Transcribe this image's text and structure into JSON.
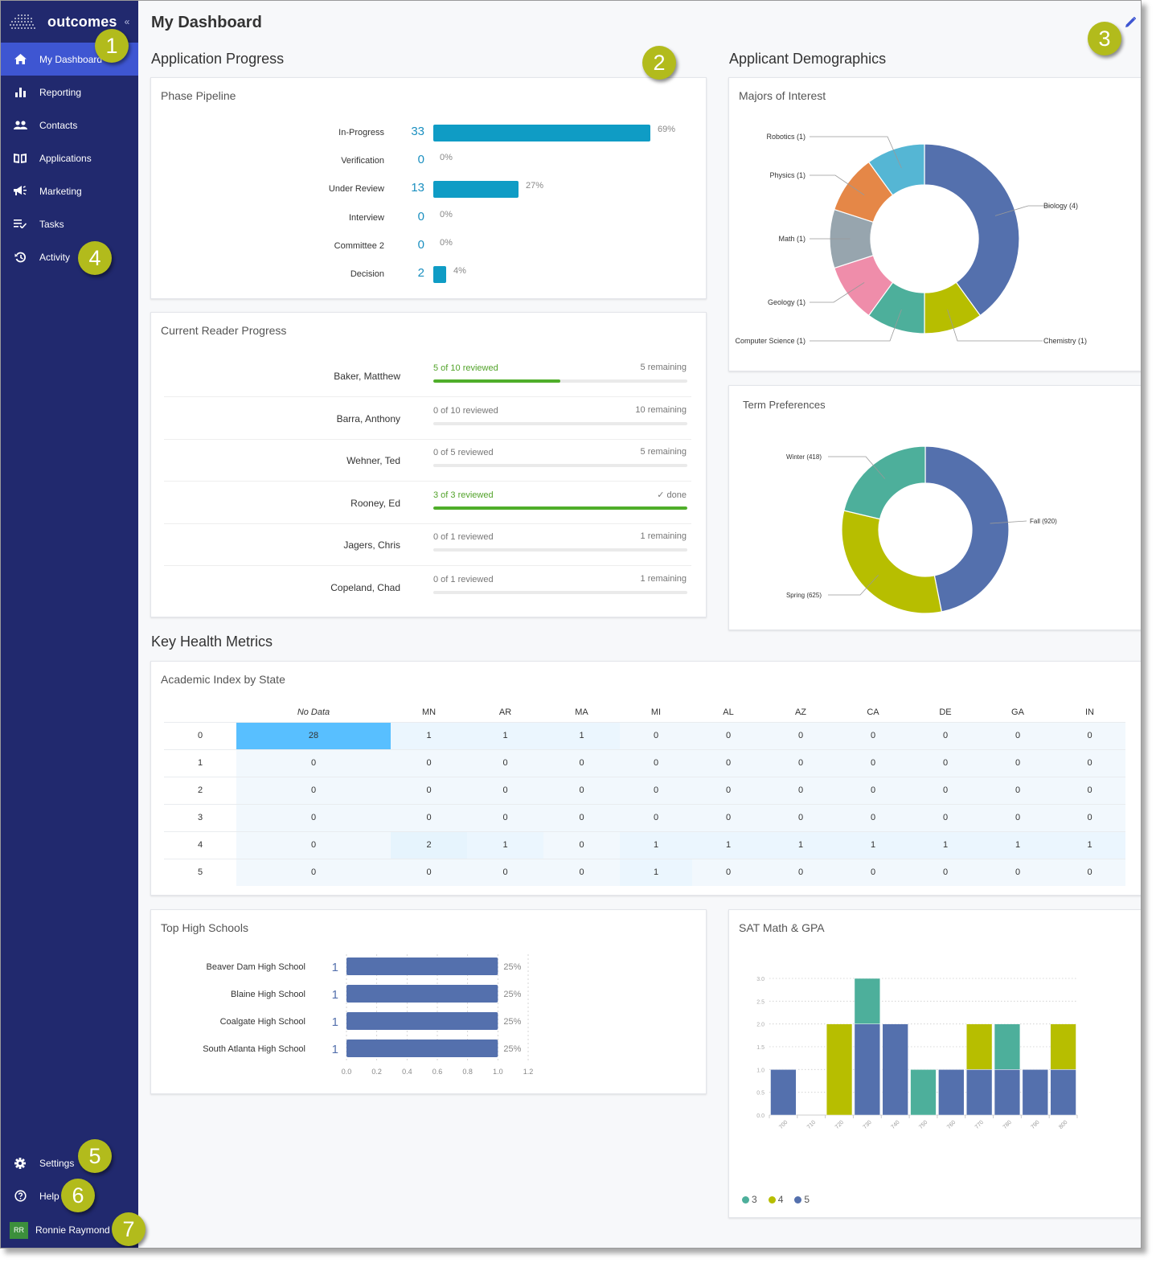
{
  "app": {
    "brand": "outcomes",
    "collapse_glyph": "«"
  },
  "sidebar": {
    "items": [
      {
        "label": "My Dashboard",
        "icon": "home-icon",
        "active": true
      },
      {
        "label": "Reporting",
        "icon": "bar-chart-icon",
        "active": false
      },
      {
        "label": "Contacts",
        "icon": "people-icon",
        "active": false
      },
      {
        "label": "Applications",
        "icon": "book-icon",
        "active": false
      },
      {
        "label": "Marketing",
        "icon": "megaphone-icon",
        "active": false
      },
      {
        "label": "Tasks",
        "icon": "tasks-icon",
        "active": false
      },
      {
        "label": "Activity",
        "icon": "history-icon",
        "active": false
      }
    ],
    "bottom": [
      {
        "label": "Settings",
        "icon": "gear-icon"
      },
      {
        "label": "Help",
        "icon": "help-icon"
      }
    ],
    "user": {
      "initials": "RR",
      "name": "Ronnie Raymond",
      "avatar_color": "#3c8f3c"
    }
  },
  "header": {
    "title": "My Dashboard",
    "edit_icon": "pencil-icon"
  },
  "sections": {
    "application_progress": "Application Progress",
    "applicant_demographics": "Applicant Demographics",
    "key_health_metrics": "Key Health Metrics"
  },
  "phase_pipeline": {
    "title": "Phase Pipeline",
    "bar_color": "#0f9cc5",
    "rows": [
      {
        "label": "In-Progress",
        "count": "33",
        "percent": "69%",
        "fraction": 0.69
      },
      {
        "label": "Verification",
        "count": "0",
        "percent": "0%",
        "fraction": 0
      },
      {
        "label": "Under Review",
        "count": "13",
        "percent": "27%",
        "fraction": 0.27
      },
      {
        "label": "Interview",
        "count": "0",
        "percent": "0%",
        "fraction": 0
      },
      {
        "label": "Committee 2",
        "count": "0",
        "percent": "0%",
        "fraction": 0
      },
      {
        "label": "Decision",
        "count": "2",
        "percent": "4%",
        "fraction": 0.04
      }
    ]
  },
  "reader_progress": {
    "title": "Current Reader Progress",
    "rows": [
      {
        "name": "Baker, Matthew",
        "status": "5 of 10 reviewed",
        "remaining": "5 remaining",
        "progress": 0.5,
        "highlight": true
      },
      {
        "name": "Barra, Anthony",
        "status": "0 of 10 reviewed",
        "remaining": "10 remaining",
        "progress": 0,
        "highlight": false
      },
      {
        "name": "Wehner, Ted",
        "status": "0 of 5 reviewed",
        "remaining": "5 remaining",
        "progress": 0,
        "highlight": false
      },
      {
        "name": "Rooney, Ed",
        "status": "3 of 3 reviewed",
        "remaining": "✓ done",
        "progress": 1,
        "highlight": true
      },
      {
        "name": "Jagers, Chris",
        "status": "0 of 1 reviewed",
        "remaining": "1 remaining",
        "progress": 0,
        "highlight": false
      },
      {
        "name": "Copeland, Chad",
        "status": "0 of 1 reviewed",
        "remaining": "1 remaining",
        "progress": 0,
        "highlight": false
      }
    ]
  },
  "majors": {
    "title": "Majors of Interest",
    "slices": [
      {
        "label": "Biology (4)",
        "value": 4,
        "color": "#5470ad"
      },
      {
        "label": "Chemistry (1)",
        "value": 1,
        "color": "#b7be00"
      },
      {
        "label": "Computer Science (1)",
        "value": 1,
        "color": "#4daf9b"
      },
      {
        "label": "Geology (1)",
        "value": 1,
        "color": "#ef8daa"
      },
      {
        "label": "Math (1)",
        "value": 1,
        "color": "#97a5ae"
      },
      {
        "label": "Physics (1)",
        "value": 1,
        "color": "#e58747"
      },
      {
        "label": "Robotics (1)",
        "value": 1,
        "color": "#55b6d4"
      }
    ]
  },
  "terms": {
    "title": "Term Preferences",
    "slices": [
      {
        "label": "Fall (920)",
        "value": 920,
        "color": "#5470ad"
      },
      {
        "label": "Spring (625)",
        "value": 625,
        "color": "#b7be00"
      },
      {
        "label": "Winter (418)",
        "value": 418,
        "color": "#4daf9b"
      }
    ]
  },
  "academic_index": {
    "title": "Academic Index by State",
    "columns": [
      "No Data",
      "MN",
      "AR",
      "MA",
      "MI",
      "AL",
      "AZ",
      "CA",
      "DE",
      "GA",
      "IN"
    ],
    "rows": [
      {
        "label": "0",
        "values": [
          28,
          1,
          1,
          1,
          0,
          0,
          0,
          0,
          0,
          0,
          0
        ]
      },
      {
        "label": "1",
        "values": [
          0,
          0,
          0,
          0,
          0,
          0,
          0,
          0,
          0,
          0,
          0
        ]
      },
      {
        "label": "2",
        "values": [
          0,
          0,
          0,
          0,
          0,
          0,
          0,
          0,
          0,
          0,
          0
        ]
      },
      {
        "label": "3",
        "values": [
          0,
          0,
          0,
          0,
          0,
          0,
          0,
          0,
          0,
          0,
          0
        ]
      },
      {
        "label": "4",
        "values": [
          0,
          2,
          1,
          0,
          1,
          1,
          1,
          1,
          1,
          1,
          1
        ]
      },
      {
        "label": "5",
        "values": [
          0,
          0,
          0,
          0,
          1,
          0,
          0,
          0,
          0,
          0,
          0
        ]
      }
    ]
  },
  "top_schools": {
    "title": "Top High Schools",
    "bar_color": "#5470ad",
    "x_ticks": [
      "0.0",
      "0.2",
      "0.4",
      "0.6",
      "0.8",
      "1.0",
      "1.2"
    ],
    "x_max": 1.2,
    "rows": [
      {
        "label": "Beaver Dam High School",
        "count": "1",
        "value": 1,
        "percent": "25%"
      },
      {
        "label": "Blaine High School",
        "count": "1",
        "value": 1,
        "percent": "25%"
      },
      {
        "label": "Coalgate High School",
        "count": "1",
        "value": 1,
        "percent": "25%"
      },
      {
        "label": "South Atlanta High School",
        "count": "1",
        "value": 1,
        "percent": "25%"
      }
    ]
  },
  "chart_data": {
    "type": "bar",
    "title": "SAT Math & GPA",
    "stacked": true,
    "categories": [
      "700",
      "710",
      "720",
      "730",
      "740",
      "750",
      "760",
      "770",
      "780",
      "790",
      "800"
    ],
    "series": [
      {
        "name": "5",
        "color": "#5470ad",
        "values": [
          1,
          0,
          0,
          2,
          2,
          0,
          1,
          1,
          1,
          1,
          1
        ]
      },
      {
        "name": "4",
        "color": "#b7be00",
        "values": [
          0,
          0,
          2,
          0,
          0,
          0,
          0,
          1,
          0,
          0,
          1
        ]
      },
      {
        "name": "3",
        "color": "#4daf9b",
        "values": [
          0,
          0,
          0,
          1,
          0,
          1,
          0,
          0,
          1,
          0,
          0
        ]
      }
    ],
    "y_ticks": [
      "0.0",
      "0.5",
      "1.0",
      "1.5",
      "2.0",
      "2.5",
      "3.0"
    ],
    "ylim": [
      0,
      3
    ],
    "grid": true,
    "legend_order": [
      "3",
      "4",
      "5"
    ],
    "legend_position": "bottom-left",
    "xlabel": "",
    "ylabel": ""
  },
  "callouts": [
    "1",
    "2",
    "3",
    "4",
    "5",
    "6",
    "7"
  ]
}
